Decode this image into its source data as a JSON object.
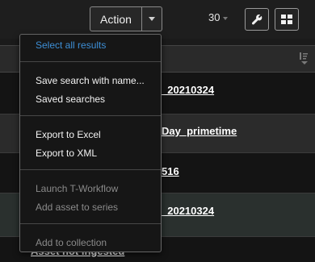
{
  "toolbar": {
    "action_label": "Action",
    "results_per_page": "30",
    "wrench_icon": "wrench-icon",
    "grid_icon": "grid-view-icon"
  },
  "rows": [
    {
      "link": "_20210324"
    },
    {
      "link": "Day_primetime"
    },
    {
      "link": "516"
    },
    {
      "link": "_20210324"
    },
    {
      "link": "Asset not ingested"
    }
  ],
  "menu": {
    "select_all": "Select all results",
    "save_search": "Save search with name...",
    "saved_searches": "Saved searches",
    "export_excel": "Export to Excel",
    "export_xml": "Export to XML",
    "launch_workflow": "Launch T-Workflow",
    "add_to_series": "Add asset to series",
    "add_to_collection": "Add to collection"
  },
  "colors": {
    "accent": "#3d8fd6",
    "menu_bg": "#161616",
    "disabled_text": "#8a8a8a"
  }
}
